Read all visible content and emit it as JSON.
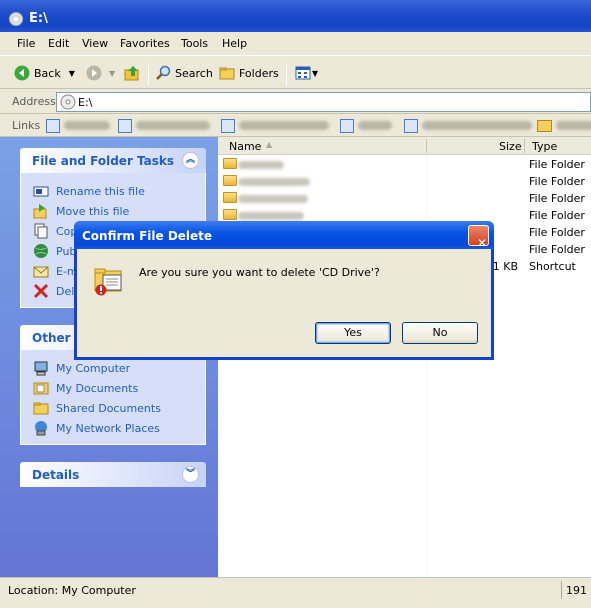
{
  "window": {
    "title": "E:\\"
  },
  "menu": [
    "File",
    "Edit",
    "View",
    "Favorites",
    "Tools",
    "Help"
  ],
  "toolbar": {
    "back": "Back",
    "search": "Search",
    "folders": "Folders"
  },
  "address": {
    "label": "Address",
    "value": "E:\\"
  },
  "links": {
    "label": "Links"
  },
  "tasks": {
    "title": "File and Folder Tasks",
    "items": [
      "Rename this file",
      "Move this file",
      "Cop",
      "Publ",
      "E-m",
      "Dele"
    ]
  },
  "other_places": {
    "title": "Other P",
    "items": [
      "My Computer",
      "My Documents",
      "Shared Documents",
      "My Network Places"
    ]
  },
  "details": {
    "title": "Details"
  },
  "columns": {
    "name": "Name",
    "size": "Size",
    "type": "Type"
  },
  "files": [
    {
      "size": "",
      "type": "File Folder"
    },
    {
      "size": "",
      "type": "File Folder"
    },
    {
      "size": "",
      "type": "File Folder"
    },
    {
      "size": "",
      "type": "File Folder"
    },
    {
      "size": "",
      "type": "File Folder"
    },
    {
      "size": "",
      "type": "File Folder"
    },
    {
      "size": "1 KB",
      "type": "Shortcut"
    }
  ],
  "status": {
    "location": "Location: My Computer",
    "right": "191"
  },
  "dialog": {
    "title": "Confirm File Delete",
    "message": "Are you sure you want to delete 'CD Drive'?",
    "yes": "Yes",
    "no": "No",
    "close": "✕"
  }
}
